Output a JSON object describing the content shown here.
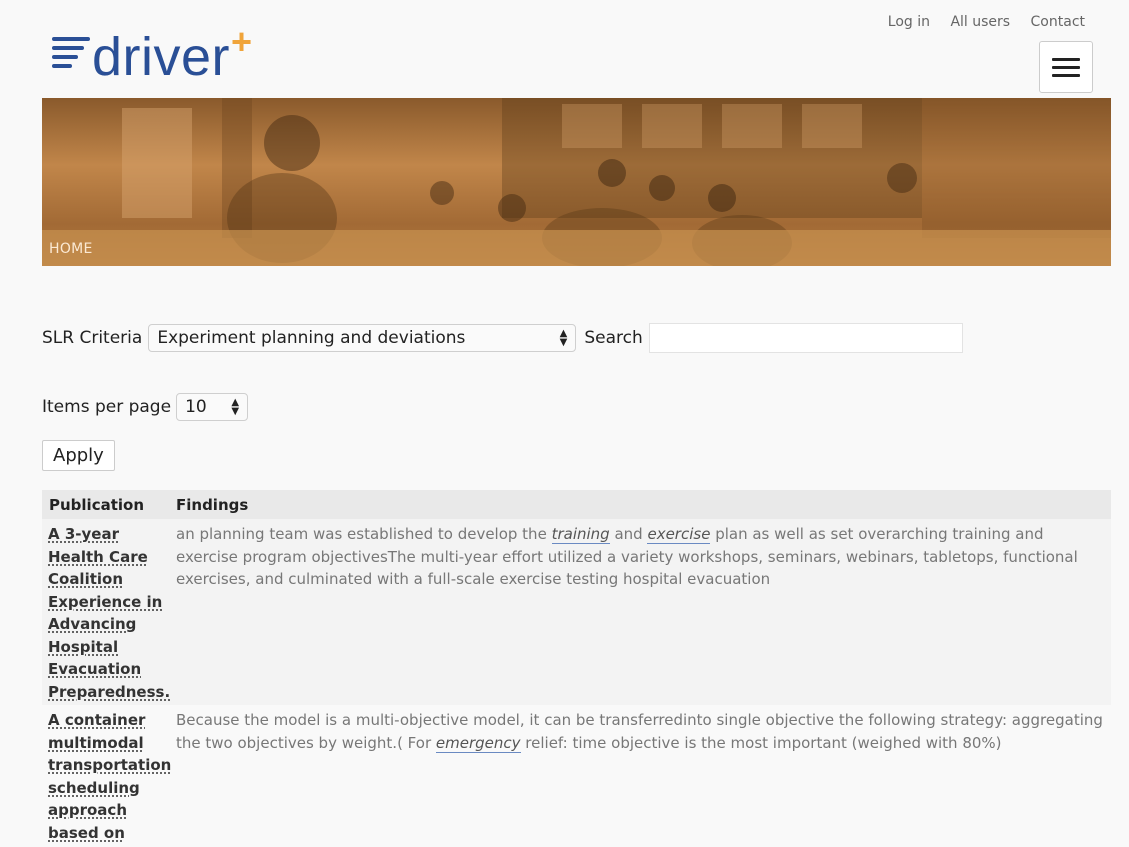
{
  "nav": {
    "login": "Log in",
    "all_users": "All users",
    "contact": "Contact"
  },
  "logo": {
    "text": "driver",
    "plus": "+"
  },
  "banner": {
    "breadcrumb": "HOME"
  },
  "filters": {
    "criteria_label": "SLR Criteria",
    "criteria_value": "Experiment planning and deviations",
    "search_label": "Search",
    "search_value": "",
    "items_label": "Items per page",
    "items_value": "10",
    "apply_label": "Apply"
  },
  "table": {
    "headers": {
      "publication": "Publication",
      "findings": "Findings"
    },
    "rows": [
      {
        "publication": "A 3-year Health Care Coalition Experience in Advancing Hospital Evacuation Preparedness.",
        "f1": "an planning team was established to develop the ",
        "k1": "training",
        "f2": " and ",
        "k2": "exercise",
        "f3": " plan as well as set overarching training and exercise program objectivesThe multi-year effort utilized a variety workshops, seminars, webinars, tabletops, functional exercises, and culminated with a full-scale exercise testing hospital evacuation"
      },
      {
        "publication": "A container multimodal transportation scheduling approach based on",
        "f1": "Because the model is a multi-objective model, it can be transferredinto single objective the following strategy: aggregating the two objectives by weight.( For ",
        "k1": "emergency",
        "f2": " relief: time objective is the most important (weighed with 80%)"
      }
    ]
  },
  "colors": {
    "brand": "#2a4f96",
    "accent": "#f0a43a",
    "banner": "#b47a40"
  }
}
